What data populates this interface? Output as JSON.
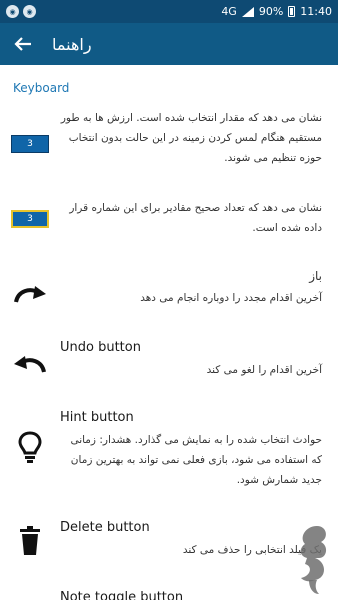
{
  "status_bar": {
    "left_icons": [
      "notification-icon",
      "notification-icon"
    ],
    "network": "4G",
    "battery": "90%",
    "time": "11:40"
  },
  "app_bar": {
    "title": "راهنما",
    "back_icon": "arrow-left-icon"
  },
  "section_title": "Keyboard",
  "items": [
    {
      "cell_value": "3",
      "description": "نشان می دهد که مقدار انتخاب شده است. ارزش ها به طور مستقیم هنگام لمس کردن زمینه در این حالت بدون انتخاب حوزه تنظیم می شوند."
    },
    {
      "cell_value": "3",
      "description": "نشان می دهد که تعداد صحیح مقادیر برای این شماره قرار داده شده است."
    },
    {
      "icon": "redo-icon",
      "title": "باز",
      "description": "آخرین اقدام مجدد را دوباره انجام می دهد"
    },
    {
      "icon": "undo-icon",
      "title": "Undo button",
      "description": "آخرین اقدام را لغو می کند"
    },
    {
      "icon": "lightbulb-icon",
      "title": "Hint button",
      "description": "حوادث انتخاب شده را به نمایش می گذارد. هشدار: زمانی که استفاده می شود، بازی فعلی نمی تواند به بهترین زمان جدید شمارش شود."
    },
    {
      "icon": "trash-icon",
      "title": "Delete button",
      "description": "یک فیلد انتخابی را حذف می کند"
    },
    {
      "title": "Note toggle button"
    }
  ],
  "colors": {
    "status_bar": "#0e4a73",
    "app_bar": "#105a86",
    "accent": "#1f78b4",
    "cell": "#1065a8",
    "cell_selected_border": "#e6c22b"
  }
}
